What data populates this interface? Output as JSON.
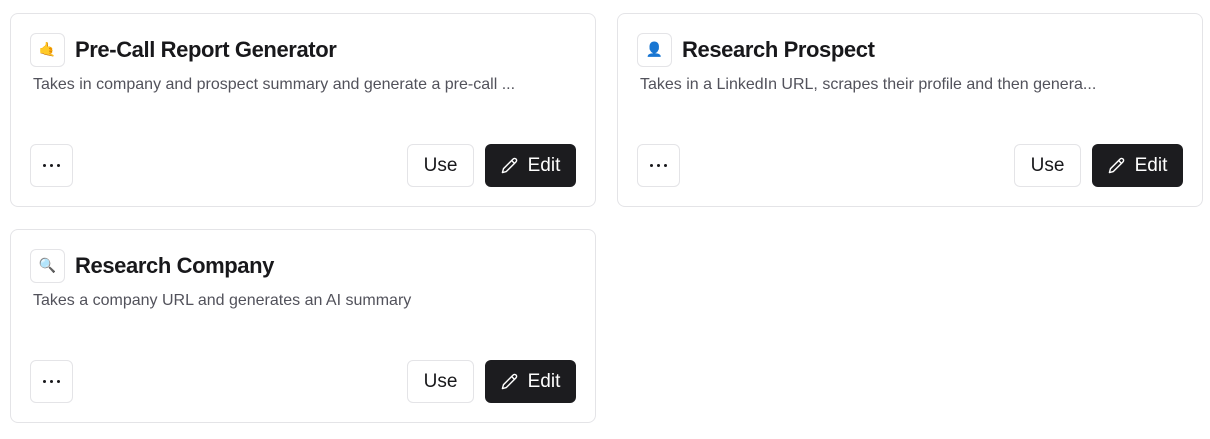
{
  "cards": [
    {
      "emoji": "🤙",
      "icon": "call-me-hand-icon",
      "title": "Pre-Call Report Generator",
      "description": "Takes in company and prospect summary and generate a pre-call ...",
      "use_label": "Use",
      "edit_label": "Edit"
    },
    {
      "emoji": "👤",
      "icon": "person-silhouette-icon",
      "title": "Research Prospect",
      "description": "Takes in a LinkedIn URL, scrapes their profile and then genera...",
      "use_label": "Use",
      "edit_label": "Edit"
    },
    {
      "emoji": "🔍",
      "icon": "magnifier-icon",
      "title": "Research Company",
      "description": "Takes a company URL and generates an AI summary",
      "use_label": "Use",
      "edit_label": "Edit"
    }
  ],
  "colors": {
    "edit_button_bg": "#1c1c1f",
    "border": "#e4e4e7",
    "description_text": "#52525b"
  }
}
